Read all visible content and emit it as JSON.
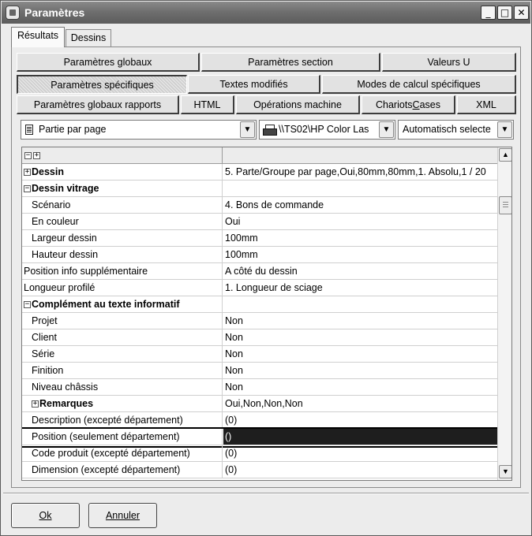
{
  "window": {
    "title": "Paramètres"
  },
  "title_controls": {
    "minimize": "_",
    "maximize": "□",
    "close": "✕"
  },
  "main_tabs": [
    "Résultats",
    "Dessins"
  ],
  "sub_tabs": {
    "row1": [
      "Paramètres globaux",
      "Paramètres section",
      "Valeurs U"
    ],
    "row2": [
      "Paramètres spécifiques",
      "Textes modifiés",
      "Modes de calcul spécifiques"
    ],
    "row3": [
      "Paramètres globaux rapports",
      "HTML",
      "Opérations machine",
      "ChariotsCases",
      "XML"
    ],
    "active": "Paramètres spécifiques"
  },
  "selectors": {
    "layout": "Partie par page",
    "printer": "\\\\TS02\\HP Color Las",
    "tray": "Automatisch selecte"
  },
  "grid": {
    "rows": [
      {
        "label": "Dessin",
        "value": "5. Parte/Groupe par page,Oui,80mm,80mm,1. Absolu,1 / 20",
        "type": "group",
        "toggle": "+",
        "indent": 0
      },
      {
        "label": "Dessin vitrage",
        "value": "",
        "type": "group",
        "toggle": "−",
        "indent": 0
      },
      {
        "label": "Scénario",
        "value": "4. Bons de commande",
        "type": "item",
        "indent": 1
      },
      {
        "label": "En couleur",
        "value": "Oui",
        "type": "item",
        "indent": 1
      },
      {
        "label": "Largeur dessin",
        "value": "100mm",
        "type": "item",
        "indent": 1
      },
      {
        "label": "Hauteur dessin",
        "value": "100mm",
        "type": "item",
        "indent": 1
      },
      {
        "label": "Position info supplémentaire",
        "value": "A côté du dessin",
        "type": "item",
        "indent": 0
      },
      {
        "label": "Longueur profilé",
        "value": "1. Longueur de sciage",
        "type": "item",
        "indent": 0
      },
      {
        "label": "Complément au texte informatif",
        "value": "",
        "type": "group",
        "toggle": "−",
        "indent": 0
      },
      {
        "label": "Projet",
        "value": "Non",
        "type": "item",
        "indent": 1
      },
      {
        "label": "Client",
        "value": "Non",
        "type": "item",
        "indent": 1
      },
      {
        "label": "Série",
        "value": "Non",
        "type": "item",
        "indent": 1
      },
      {
        "label": "Finition",
        "value": "Non",
        "type": "item",
        "indent": 1
      },
      {
        "label": "Niveau châssis",
        "value": "Non",
        "type": "item",
        "indent": 1
      },
      {
        "label": "Remarques",
        "value": "Oui,Non,Non,Non",
        "type": "group",
        "toggle": "+",
        "indent": 1
      },
      {
        "label": "Description (excepté département)",
        "value": "(0)",
        "type": "item",
        "indent": 1
      },
      {
        "label": "Position (seulement département)",
        "value": "()",
        "type": "item",
        "indent": 1,
        "selected": true
      },
      {
        "label": "Code produit (excepté département)",
        "value": "(0)",
        "type": "item",
        "indent": 1
      },
      {
        "label": "Dimension (excepté département)",
        "value": "(0)",
        "type": "item",
        "indent": 1
      }
    ]
  },
  "buttons": {
    "ok": "Ok",
    "cancel": "Annuler"
  },
  "colors": {
    "titlebar": "#6f6f6f",
    "selection": "#1e1e1e",
    "background": "#ececec"
  }
}
